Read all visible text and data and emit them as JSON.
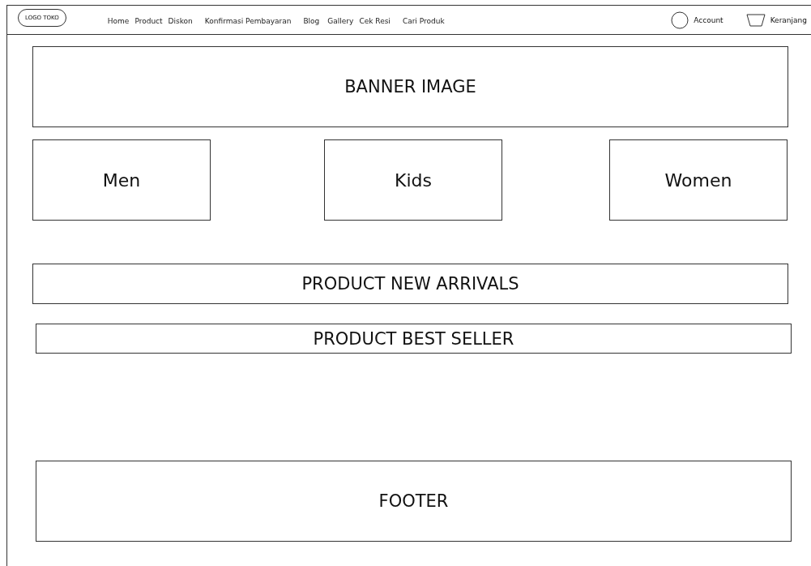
{
  "header": {
    "logo": "LOGO TOKO",
    "nav": [
      "Home",
      "Product",
      "Diskon",
      "Konfirmasi Pembayaran",
      "Blog",
      "Gallery",
      "Cek Resi",
      "Cari Produk"
    ],
    "account": "Account",
    "cart": "Keranjang"
  },
  "banner": "BANNER IMAGE",
  "categories": [
    "Men",
    "Kids",
    "Women"
  ],
  "sections": [
    "PRODUCT NEW ARRIVALS",
    "PRODUCT BEST SELLER"
  ],
  "footer": "FOOTER"
}
